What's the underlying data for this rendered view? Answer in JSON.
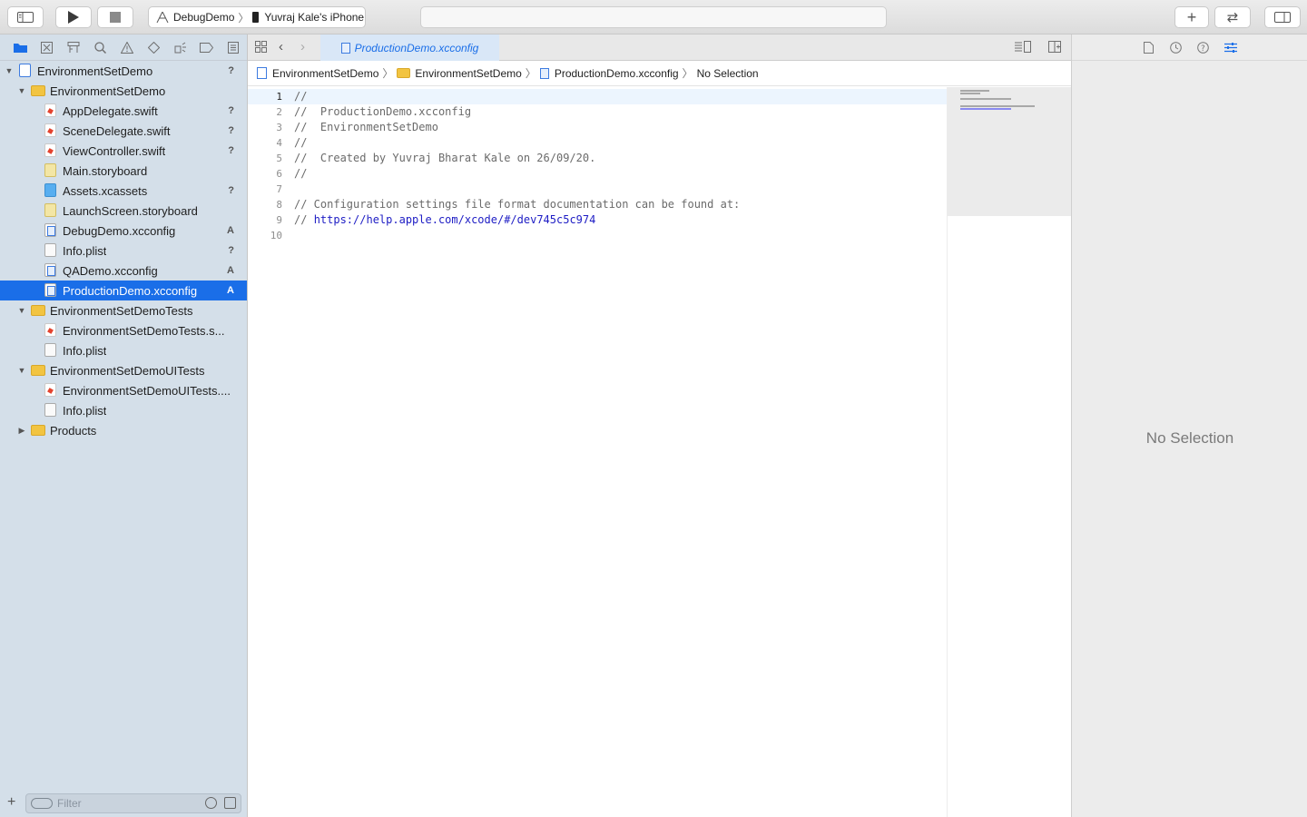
{
  "toolbar": {
    "scheme": "DebugDemo",
    "device": "Yuvraj  Kale's iPhone"
  },
  "navigator": {
    "items": [
      {
        "label": "EnvironmentSetDemo",
        "kind": "project",
        "status": "?"
      },
      {
        "label": "EnvironmentSetDemo",
        "kind": "folder",
        "status": ""
      },
      {
        "label": "AppDelegate.swift",
        "kind": "swift",
        "status": "?"
      },
      {
        "label": "SceneDelegate.swift",
        "kind": "swift",
        "status": "?"
      },
      {
        "label": "ViewController.swift",
        "kind": "swift",
        "status": "?"
      },
      {
        "label": "Main.storyboard",
        "kind": "storyboard",
        "status": ""
      },
      {
        "label": "Assets.xcassets",
        "kind": "assets",
        "status": "?"
      },
      {
        "label": "LaunchScreen.storyboard",
        "kind": "storyboard",
        "status": ""
      },
      {
        "label": "DebugDemo.xcconfig",
        "kind": "xcconfig",
        "status": "A"
      },
      {
        "label": "Info.plist",
        "kind": "plist",
        "status": "?"
      },
      {
        "label": "QADemo.xcconfig",
        "kind": "xcconfig",
        "status": "A"
      },
      {
        "label": "ProductionDemo.xcconfig",
        "kind": "xcconfig",
        "status": "A"
      },
      {
        "label": "EnvironmentSetDemoTests",
        "kind": "folder",
        "status": ""
      },
      {
        "label": "EnvironmentSetDemoTests.s...",
        "kind": "swift",
        "status": ""
      },
      {
        "label": "Info.plist",
        "kind": "plist",
        "status": ""
      },
      {
        "label": "EnvironmentSetDemoUITests",
        "kind": "folder",
        "status": ""
      },
      {
        "label": "EnvironmentSetDemoUITests....",
        "kind": "swift",
        "status": ""
      },
      {
        "label": "Info.plist",
        "kind": "plist",
        "status": ""
      },
      {
        "label": "Products",
        "kind": "folder",
        "status": ""
      }
    ],
    "filter_placeholder": "Filter"
  },
  "editor": {
    "tab_title": "ProductionDemo.xcconfig",
    "jumpbar": [
      "EnvironmentSetDemo",
      "EnvironmentSetDemo",
      "ProductionDemo.xcconfig",
      "No Selection"
    ],
    "lines": [
      {
        "n": "1",
        "text": "//"
      },
      {
        "n": "2",
        "text": "//  ProductionDemo.xcconfig"
      },
      {
        "n": "3",
        "text": "//  EnvironmentSetDemo"
      },
      {
        "n": "4",
        "text": "//"
      },
      {
        "n": "5",
        "text": "//  Created by Yuvraj Bharat Kale on 26/09/20."
      },
      {
        "n": "6",
        "text": "//"
      },
      {
        "n": "7",
        "text": ""
      },
      {
        "n": "8",
        "text": "// Configuration settings file format documentation can be found at:"
      },
      {
        "n": "9",
        "text": "// ",
        "link": "https://help.apple.com/xcode/#/dev745c5c974"
      },
      {
        "n": "10",
        "text": ""
      }
    ]
  },
  "inspector": {
    "empty_text": "No Selection"
  },
  "colors": {
    "accent": "#1a6ee8",
    "sidebar": "#d4dfe9",
    "link": "#1d1cc4"
  }
}
